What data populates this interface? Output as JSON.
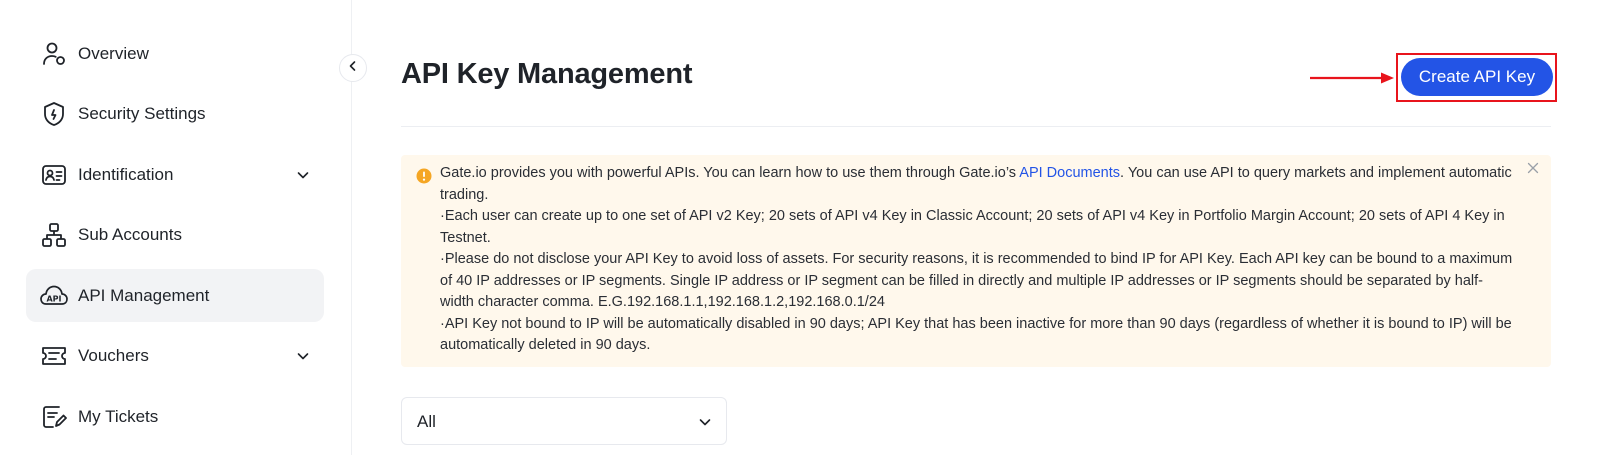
{
  "sidebar": {
    "items": [
      {
        "label": "Overview",
        "icon": "user-overview-icon",
        "has_chevron": false
      },
      {
        "label": "Security Settings",
        "icon": "shield-icon",
        "has_chevron": false
      },
      {
        "label": "Identification",
        "icon": "id-card-icon",
        "has_chevron": true
      },
      {
        "label": "Sub Accounts",
        "icon": "sub-accounts-icon",
        "has_chevron": false
      },
      {
        "label": "API Management",
        "icon": "api-icon",
        "has_chevron": false,
        "active": true
      },
      {
        "label": "Vouchers",
        "icon": "voucher-icon",
        "has_chevron": true
      },
      {
        "label": "My Tickets",
        "icon": "ticket-icon",
        "has_chevron": false
      }
    ]
  },
  "main": {
    "title": "API Key Management",
    "create_button_label": "Create API Key",
    "notice": {
      "intro_before_link": "Gate.io provides you with powerful APIs. You can learn how to use them through Gate.io’s ",
      "link_text": "API Documents",
      "intro_after_link": ". You can use API to query markets and implement automatic trading.",
      "bullet_1": "·Each user can create up to one set of API v2 Key; 20 sets of API v4 Key in Classic Account; 20 sets of API v4 Key in Portfolio Margin Account; 20 sets of API 4 Key in Testnet.",
      "bullet_2": "·Please do not disclose your API Key to avoid loss of assets. For security reasons, it is recommended to bind IP for API Key. Each API key can be bound to a maximum of 40 IP addresses or IP segments. Single IP address or IP segment can be filled in directly and multiple IP addresses or IP segments should be separated by half-width character comma. E.G.192.168.1.1,192.168.1.2,192.168.0.1/24",
      "bullet_3": "·API Key not bound to IP will be automatically disabled in 90 days; API Key that has been inactive for more than 90 days (regardless of whether it is bound to IP) will be automatically deleted in 90 days."
    },
    "filter": {
      "selected": "All"
    }
  },
  "colors": {
    "accent": "#2354e6",
    "highlight_red": "#e8141c",
    "notice_bg": "#fff8ec",
    "warning_icon": "#f5a623",
    "active_nav_bg": "#f2f3f5"
  }
}
